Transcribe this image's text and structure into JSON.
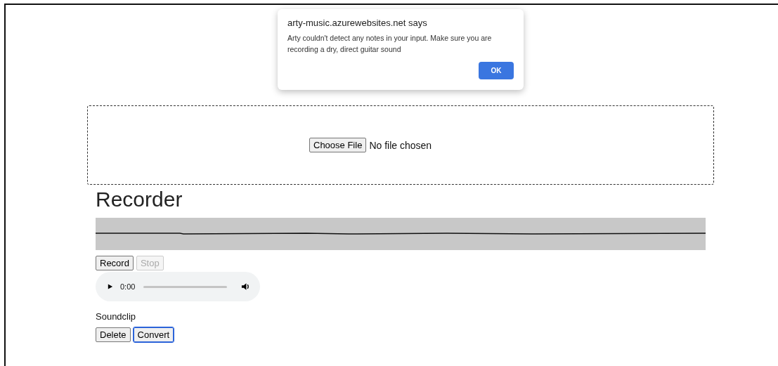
{
  "dialog": {
    "origin": "arty-music.azurewebsites.net says",
    "message": "Arty couldn't detect any notes in your input. Make sure you are recording a dry, direct guitar sound",
    "button": "OK"
  },
  "dropzone": {
    "button": "Choose File",
    "status": "No file chosen"
  },
  "recorder": {
    "heading": "Recorder",
    "controls": [
      {
        "label": "Record",
        "disabled": false
      },
      {
        "label": "Stop",
        "disabled": true
      }
    ],
    "player": {
      "time": "0:00"
    },
    "clip": {
      "label": "Soundclip",
      "buttons": [
        {
          "label": "Delete",
          "focused": false
        },
        {
          "label": "Convert",
          "focused": true
        }
      ]
    }
  }
}
